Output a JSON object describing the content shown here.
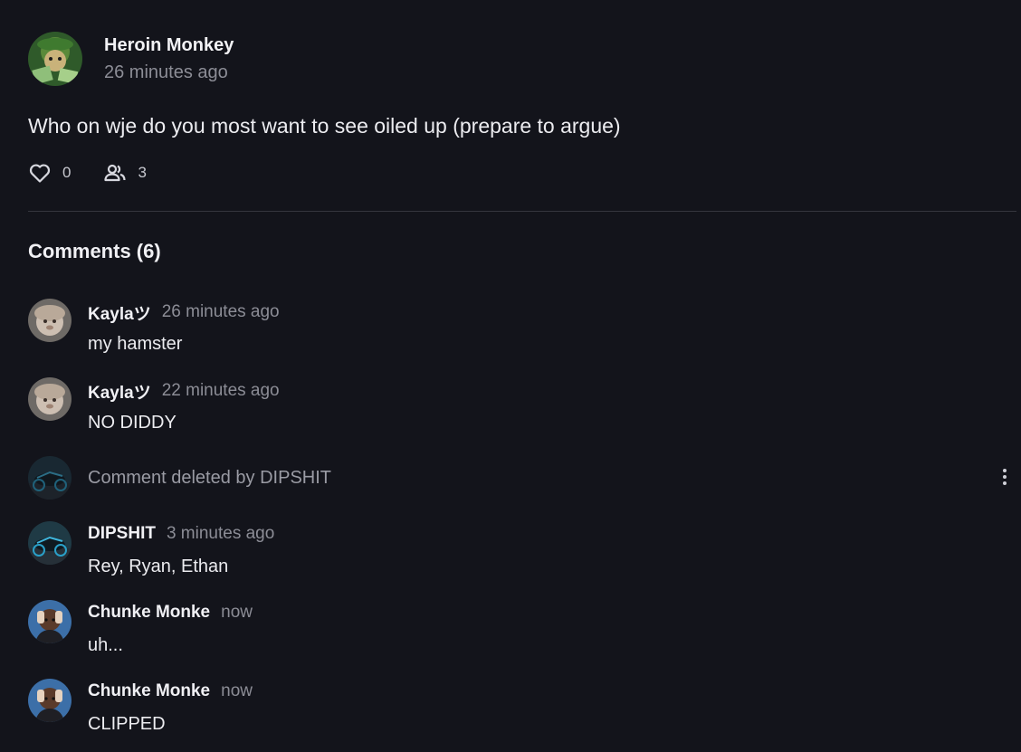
{
  "post": {
    "author": "Heroin Monkey",
    "time": "26 minutes ago",
    "text": "Who on wje do you most want to see oiled up (prepare to argue)",
    "likes": "0",
    "participants": "3",
    "icons": {
      "like": "heart-icon",
      "participants": "people-icon"
    }
  },
  "comments_heading": "Comments (6)",
  "comments": [
    {
      "author": "Kaylaツ",
      "time": "26 minutes ago",
      "text": "my hamster"
    },
    {
      "author": "Kaylaツ",
      "time": "22 minutes ago",
      "text": "NO DIDDY"
    },
    {
      "deleted_text": "Comment deleted by DIPSHIT"
    },
    {
      "author": "DIPSHIT",
      "time": "3 minutes ago",
      "text": "Rey, Ryan, Ethan"
    },
    {
      "author": "Chunke Monke",
      "time": "now",
      "text": "uh..."
    },
    {
      "author": "Chunke Monke",
      "time": "now",
      "text": "CLIPPED"
    }
  ],
  "colors": {
    "background": "#13141b",
    "muted_text": "#8c8d96",
    "divider": "#34353e"
  }
}
